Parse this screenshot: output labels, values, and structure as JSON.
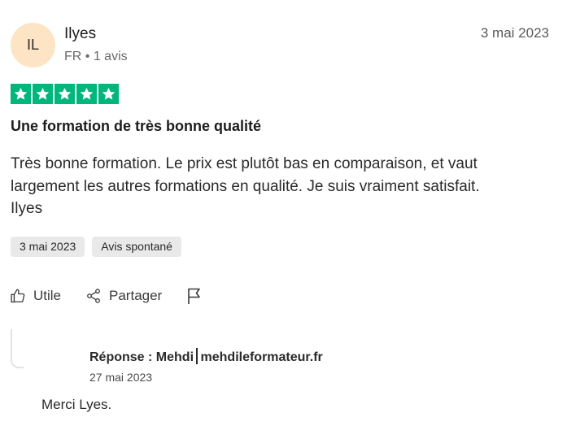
{
  "reviewer": {
    "initials": "IL",
    "name": "Ilyes",
    "meta": "FR • 1 avis"
  },
  "review": {
    "date": "3 mai 2023",
    "rating": 5,
    "rating_max": 5,
    "star_color": "#00b67a",
    "title": "Une formation de très bonne qualité",
    "body_line1": "Très bonne formation. Le prix est plutôt bas en comparaison, et vaut",
    "body_line2": "largement les autres formations en qualité. Je suis vraiment satisfait.",
    "body_line3": "Ilyes",
    "badges": [
      "3 mai 2023",
      "Avis spontané"
    ]
  },
  "actions": {
    "like_label": "Utile",
    "share_label": "Partager",
    "report_icon": "flag-icon"
  },
  "reply": {
    "label": "Réponse : Mehdi",
    "company": "mehdileformateur.fr",
    "date": "27 mai 2023",
    "text": "Merci Lyes."
  }
}
